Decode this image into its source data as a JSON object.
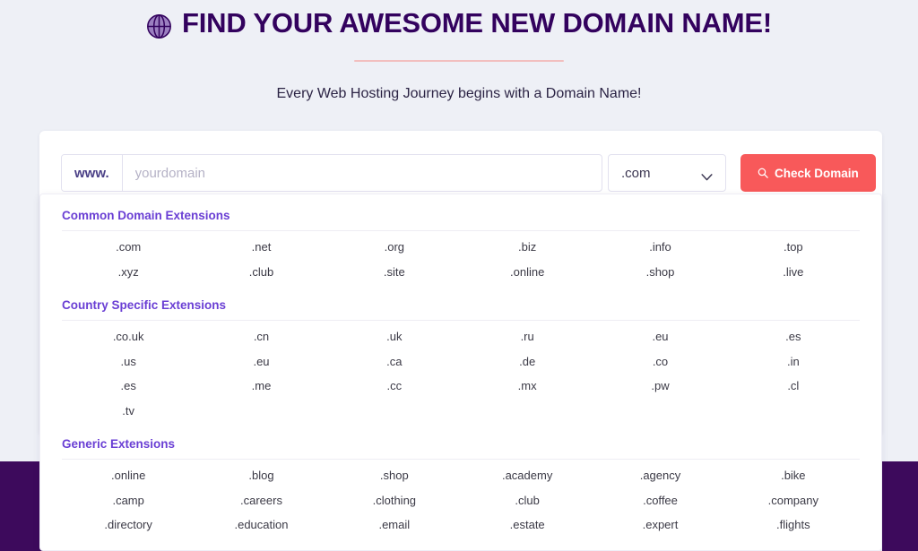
{
  "hero": {
    "icon": "globe-icon",
    "title": "FIND YOUR AWESOME NEW DOMAIN NAME!",
    "subtitle": "Every Web Hosting Journey begins with a Domain Name!",
    "title_color": "#33025e",
    "rule_color": "#f2bfbf"
  },
  "search": {
    "prefix_label": "www.",
    "input_value": "",
    "input_placeholder": "yourdomain",
    "tld_selected": ".com",
    "tld_caret_icon": "chevron-down-icon",
    "button_label": "Check Domain",
    "button_icon": "search-icon",
    "button_color": "#f8595a"
  },
  "extensions": {
    "accent_color": "#6a3fd4",
    "sections": [
      {
        "title": "Common Domain Extensions",
        "items": [
          ".com",
          ".net",
          ".org",
          ".biz",
          ".info",
          ".top",
          ".xyz",
          ".club",
          ".site",
          ".online",
          ".shop",
          ".live"
        ]
      },
      {
        "title": "Country Specific Extensions",
        "items": [
          ".co.uk",
          ".cn",
          ".uk",
          ".ru",
          ".eu",
          ".es",
          ".us",
          ".eu",
          ".ca",
          ".de",
          ".co",
          ".in",
          ".es",
          ".me",
          ".cc",
          ".mx",
          ".pw",
          ".cl",
          ".tv",
          "",
          "",
          "",
          "",
          ""
        ]
      },
      {
        "title": "Generic Extensions",
        "items": [
          ".online",
          ".blog",
          ".shop",
          ".academy",
          ".agency",
          ".bike",
          ".camp",
          ".careers",
          ".clothing",
          ".club",
          ".coffee",
          ".company",
          ".directory",
          ".education",
          ".email",
          ".estate",
          ".expert",
          ".flights"
        ]
      }
    ]
  },
  "decor": {
    "band_color": "#3d0a5c"
  }
}
